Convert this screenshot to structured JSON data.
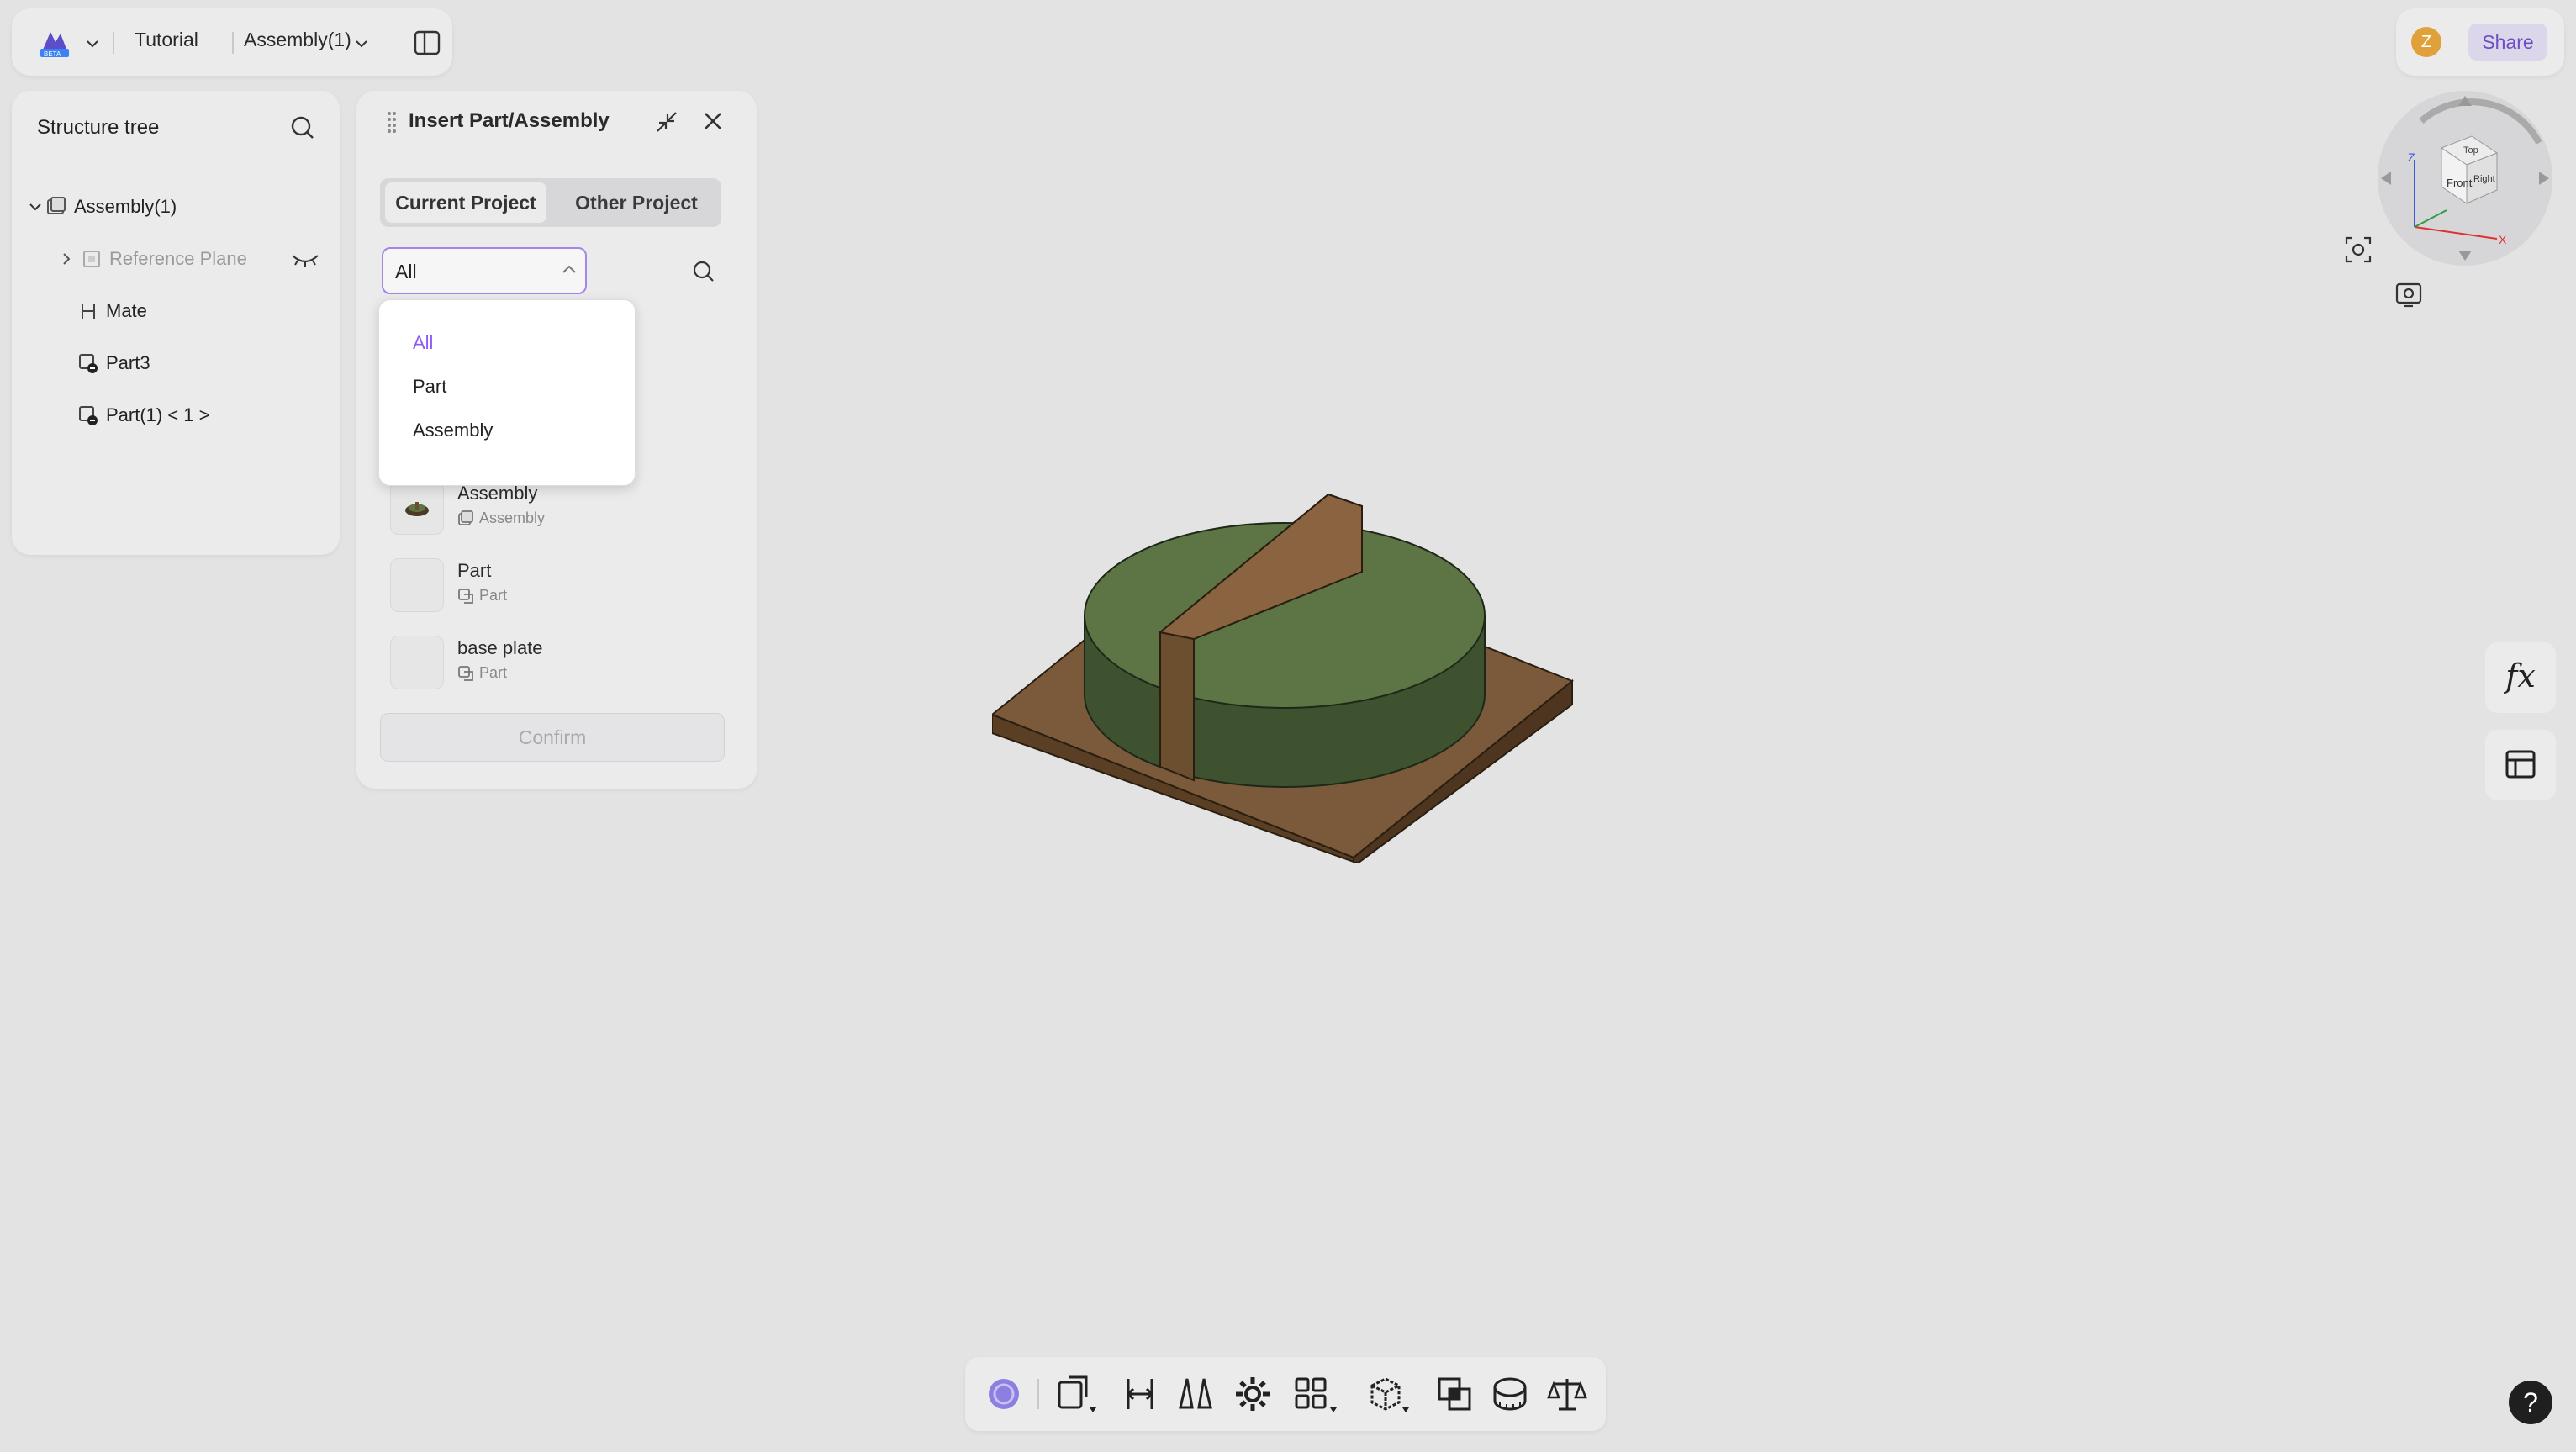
{
  "topbar": {
    "brand_badge": "BETA",
    "project": "Tutorial",
    "document": "Assembly(1)"
  },
  "topright": {
    "avatar_letter": "Z",
    "share_label": "Share"
  },
  "tree": {
    "title": "Structure tree",
    "items": [
      {
        "label": "Assembly(1)"
      },
      {
        "label": "Reference Plane"
      },
      {
        "label": "Mate"
      },
      {
        "label": "Part3"
      },
      {
        "label": "Part(1) < 1 >"
      }
    ]
  },
  "insert_dialog": {
    "title": "Insert Part/Assembly",
    "tabs": [
      "Current Project",
      "Other Project"
    ],
    "filter_value": "All",
    "filter_options": [
      "All",
      "Part",
      "Assembly"
    ],
    "items": [
      {
        "name": "Assembly",
        "type": "Assembly"
      },
      {
        "name": "Part",
        "type": "Part"
      },
      {
        "name": "base plate",
        "type": "Part"
      }
    ],
    "confirm_label": "Confirm"
  },
  "side_tools": {
    "formula_label": "fx"
  },
  "navcube": {
    "faces": [
      "Top",
      "Front",
      "Right"
    ],
    "axes": [
      "Z",
      "X"
    ]
  },
  "help_label": "?",
  "colors": {
    "accent": "#8b5cf6",
    "background": "#e3e3e4",
    "panel": "#ebebec",
    "model_plate": "#7a5a3a",
    "model_cylinder": "#5d7545"
  }
}
